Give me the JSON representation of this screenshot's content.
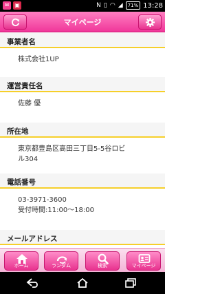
{
  "status_bar": {
    "time": "13:28",
    "battery": "71%",
    "icons": [
      "mail-icon",
      "notification-icon",
      "nfc-icon",
      "vibrate-icon",
      "wifi-icon",
      "signal-icon",
      "battery-icon"
    ]
  },
  "header": {
    "title": "マイページ",
    "left_icon": "refresh-icon",
    "right_icon": "gear-icon"
  },
  "sections": [
    {
      "heading": "事業者名",
      "lines": [
        "株式会社1UP"
      ]
    },
    {
      "heading": "運営責任名",
      "lines": [
        "佐藤 優"
      ]
    },
    {
      "heading": "所在地",
      "lines": [
        "東京都豊島区高田三丁目5-5谷ロビ",
        "ル304"
      ]
    },
    {
      "heading": "電話番号",
      "lines": [
        "03-3971-3600",
        "受付時間:11:00～18:00"
      ]
    },
    {
      "heading": "メールアドレス",
      "lines": []
    }
  ],
  "tabs": [
    {
      "label": "ホーム",
      "icon": "home-icon"
    },
    {
      "label": "ランダム",
      "icon": "random-icon"
    },
    {
      "label": "検索",
      "icon": "search-icon"
    },
    {
      "label": "マイページ",
      "icon": "id-card-icon"
    }
  ],
  "colors": {
    "accent_pink": "#f0379a",
    "section_rule_yellow": "#f6cf2a"
  }
}
